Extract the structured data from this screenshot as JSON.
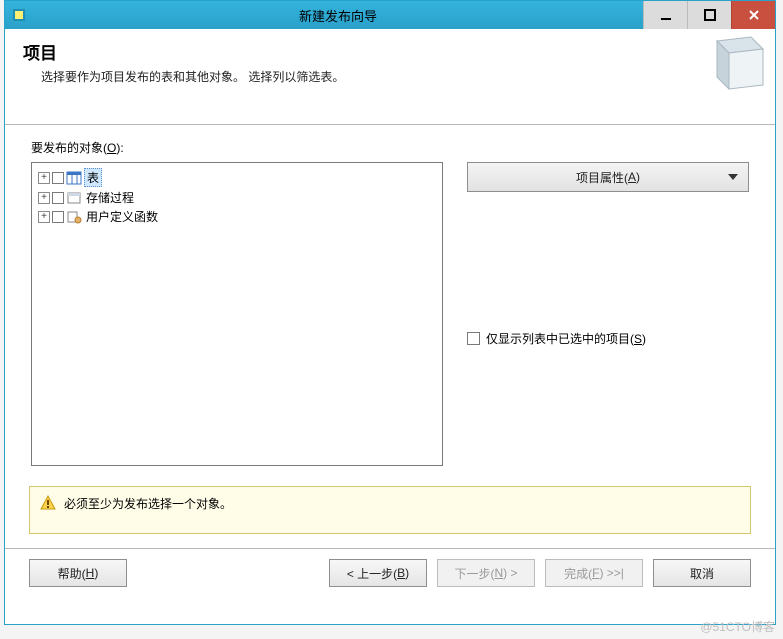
{
  "window": {
    "title": "新建发布向导"
  },
  "header": {
    "title": "项目",
    "subtitle": "选择要作为项目发布的表和其他对象。 选择列以筛选表。"
  },
  "objects": {
    "label_pre": "要发布的对象(",
    "label_key": "O",
    "label_post": "):",
    "tree": [
      {
        "label": "表",
        "selected": true
      },
      {
        "label": "存储过程",
        "selected": false
      },
      {
        "label": "用户定义函数",
        "selected": false
      }
    ]
  },
  "properties_button": {
    "label_pre": "项目属性(",
    "label_key": "A",
    "label_post": ")"
  },
  "only_selected": {
    "label_pre": "仅显示列表中已选中的项目(",
    "label_key": "S",
    "label_post": ")"
  },
  "warning": {
    "text": "必须至少为发布选择一个对象。"
  },
  "footer": {
    "help": {
      "pre": "帮助(",
      "key": "H",
      "post": ")"
    },
    "back": {
      "pre": "< 上一步(",
      "key": "B",
      "post": ")"
    },
    "next": {
      "pre": "下一步(",
      "key": "N",
      "post": ") >"
    },
    "finish": {
      "pre": "完成(",
      "key": "F",
      "post": ") >>|"
    },
    "cancel": {
      "label": "取消"
    }
  },
  "watermark": "@51CTO博客"
}
